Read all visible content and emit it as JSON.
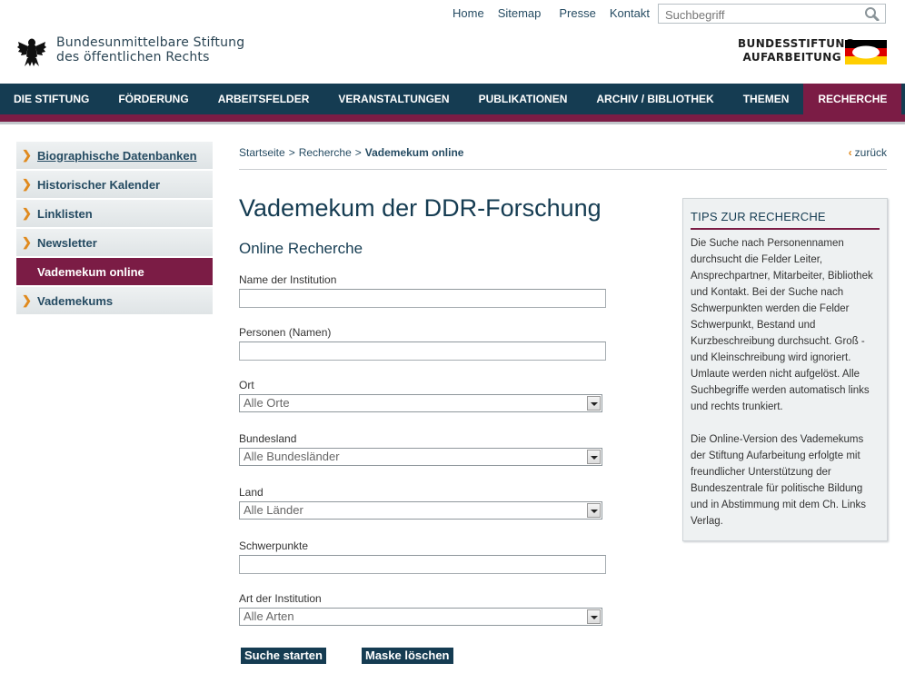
{
  "util_nav": [
    "Home",
    "Sitemap",
    "Presse",
    "Kontakt"
  ],
  "search": {
    "placeholder": "Suchbegriff",
    "icon": "magnifier-icon"
  },
  "brand": {
    "line1": "Bundesunmittelbare Stiftung",
    "line2": "des öffentlichen Rechts",
    "logo_line1": "BUNDESSTIFTUNG",
    "logo_line2": "AUFARBEITUNG",
    "icons": [
      "federal-eagle-icon",
      "german-flag-icon"
    ]
  },
  "main_nav": [
    {
      "label": "DIE STIFTUNG",
      "active": false
    },
    {
      "label": "FÖRDERUNG",
      "active": false
    },
    {
      "label": "ARBEITSFELDER",
      "active": false
    },
    {
      "label": "VERANSTALTUNGEN",
      "active": false
    },
    {
      "label": "PUBLIKATIONEN",
      "active": false
    },
    {
      "label": "ARCHIV / BIBLIOTHEK",
      "active": false
    },
    {
      "label": "THEMEN",
      "active": false
    },
    {
      "label": "RECHERCHE",
      "active": true
    }
  ],
  "sidebar": [
    {
      "label": "Biographische Datenbanken",
      "active": false
    },
    {
      "label": "Historischer Kalender",
      "active": false
    },
    {
      "label": "Linklisten",
      "active": false
    },
    {
      "label": "Newsletter",
      "active": false
    },
    {
      "label": "Vademekum online",
      "active": true
    },
    {
      "label": "Vademekums",
      "active": false
    }
  ],
  "breadcrumb": {
    "items": [
      "Startseite",
      "Recherche"
    ],
    "separator": ">",
    "current": "Vademekum online",
    "back_label": "zurück"
  },
  "page": {
    "title": "Vademekum der DDR-Forschung",
    "subtitle": "Online Recherche"
  },
  "form": {
    "institution_label": "Name der Institution",
    "institution_value": "",
    "persons_label": "Personen (Namen)",
    "persons_value": "",
    "ort_label": "Ort",
    "ort_selected": "Alle Orte",
    "bundesland_label": "Bundesland",
    "bundesland_selected": "Alle Bundesländer",
    "land_label": "Land",
    "land_selected": "Alle Länder",
    "schwerpunkte_label": "Schwerpunkte",
    "schwerpunkte_value": "",
    "art_label": "Art der Institution",
    "art_selected": "Alle Arten",
    "submit_label": "Suche starten",
    "reset_label": "Maske löschen"
  },
  "tips": {
    "title": "TIPS ZUR RECHERCHE",
    "p1": "Die Suche nach Personennamen durchsucht die Felder Leiter, Ansprechpartner, Mitarbeiter, Bibliothek und Kontakt. Bei der Suche nach Schwerpunkten werden die Felder Schwerpunkt, Bestand und Kurzbeschreibung durchsucht. Groß - und Kleinschreibung wird ignoriert. Umlaute werden nicht aufgelöst. Alle Suchbegriffe werden automatisch links und rechts trunkiert.",
    "p2": "Die Online-Version des Vademekums der Stiftung Aufarbeitung erfolgte mit freundlicher Unterstützung der Bundeszentrale für politische Bildung und in Abstimmung mit dem Ch. Links Verlag."
  },
  "colors": {
    "nav_bg": "#153c52",
    "accent": "#7b1c45",
    "chevron": "#e08a1e",
    "link": "#254b62"
  }
}
